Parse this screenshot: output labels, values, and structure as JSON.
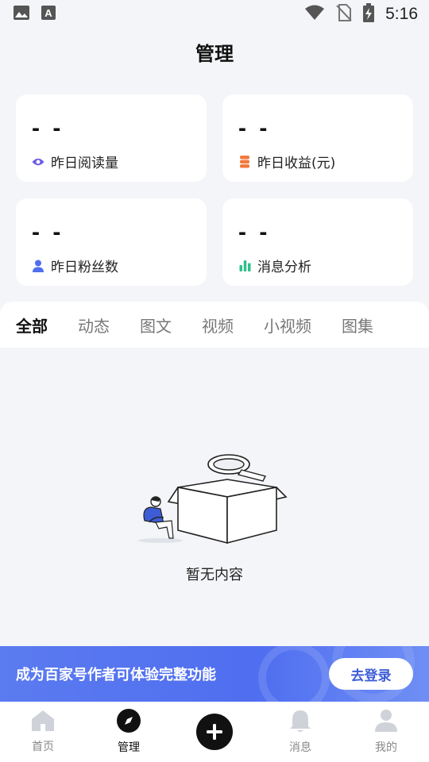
{
  "status_bar": {
    "time": "5:16"
  },
  "page": {
    "title": "管理"
  },
  "stats": [
    {
      "value": "- -",
      "label": "昨日阅读量",
      "icon": "eye-icon",
      "color": "#6b5ce7"
    },
    {
      "value": "- -",
      "label": "昨日收益(元)",
      "icon": "coin-stack-icon",
      "color": "#f07a3c"
    },
    {
      "value": "- -",
      "label": "昨日粉丝数",
      "icon": "user-icon",
      "color": "#4f6ef0"
    },
    {
      "value": "- -",
      "label": "消息分析",
      "icon": "bar-chart-icon",
      "color": "#2fbf8a"
    }
  ],
  "tabs": [
    {
      "label": "全部",
      "active": true
    },
    {
      "label": "动态"
    },
    {
      "label": "图文"
    },
    {
      "label": "视频"
    },
    {
      "label": "小视频"
    },
    {
      "label": "图集"
    }
  ],
  "empty_state": {
    "text": "暂无内容"
  },
  "banner": {
    "text": "成为百家号作者可体验完整功能",
    "button_label": "去登录"
  },
  "bottom_nav": [
    {
      "label": "首页",
      "icon": "home-icon"
    },
    {
      "label": "管理",
      "icon": "compass-icon",
      "active": true
    },
    {
      "label": "",
      "icon": "plus-icon"
    },
    {
      "label": "消息",
      "icon": "bell-icon"
    },
    {
      "label": "我的",
      "icon": "profile-icon"
    }
  ]
}
